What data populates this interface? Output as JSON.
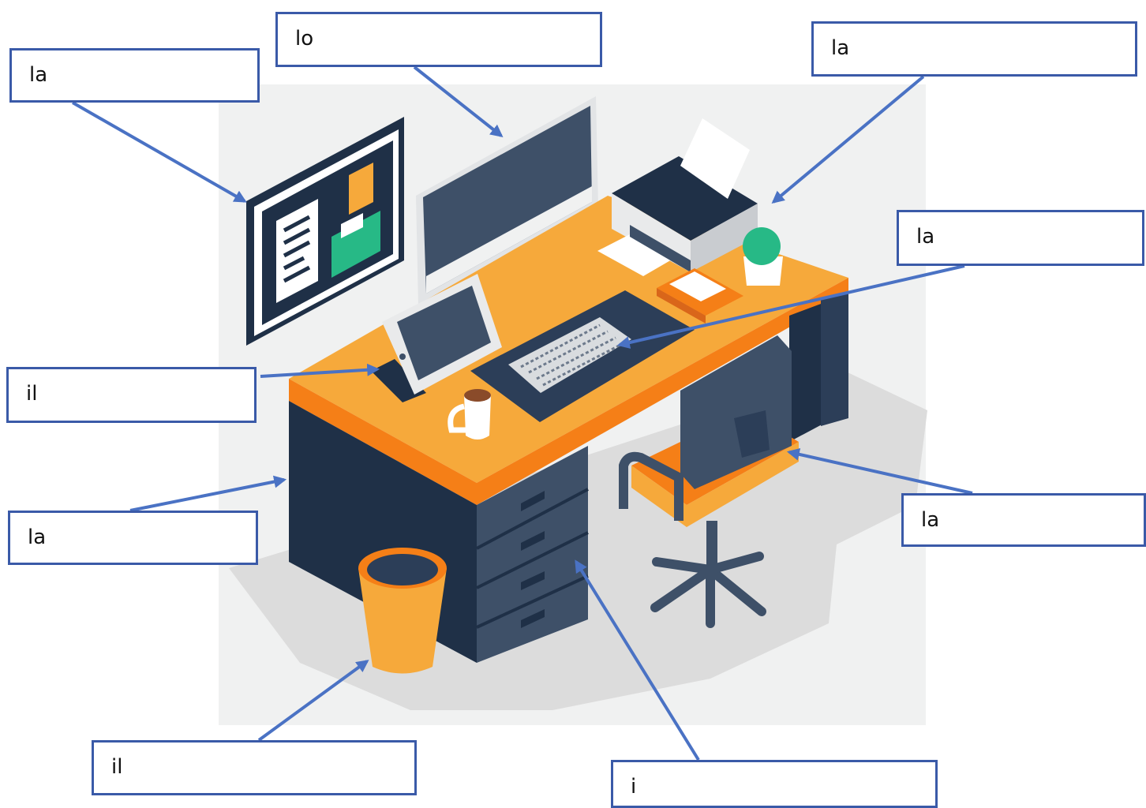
{
  "colors": {
    "label_border": "#3a5aa8",
    "arrow": "#4a72c4",
    "backdrop": "#f0f1f1",
    "navy": "#1f3047",
    "slate": "#3e5068",
    "orange": "#f6a93b",
    "deep_orange": "#f57f17",
    "shadow": "#dcdcdc"
  },
  "labels": {
    "bulletin_board": "la",
    "monitor": "lo",
    "printer": "la",
    "keyboard": "la",
    "tablet": "il",
    "desk": "la",
    "chair": "la",
    "wastebasket": "il",
    "drawers": "i"
  },
  "icons": {
    "bulletin_board": "bulletin-board-icon",
    "monitor": "monitor-icon",
    "printer": "printer-icon",
    "keyboard": "keyboard-icon",
    "tablet": "tablet-icon",
    "desk": "desk-icon",
    "chair": "office-chair-icon",
    "wastebasket": "wastebasket-icon",
    "drawers": "drawers-icon",
    "mug": "coffee-mug-icon",
    "plant": "plant-icon",
    "book": "book-icon",
    "mouse": "mouse-icon"
  }
}
